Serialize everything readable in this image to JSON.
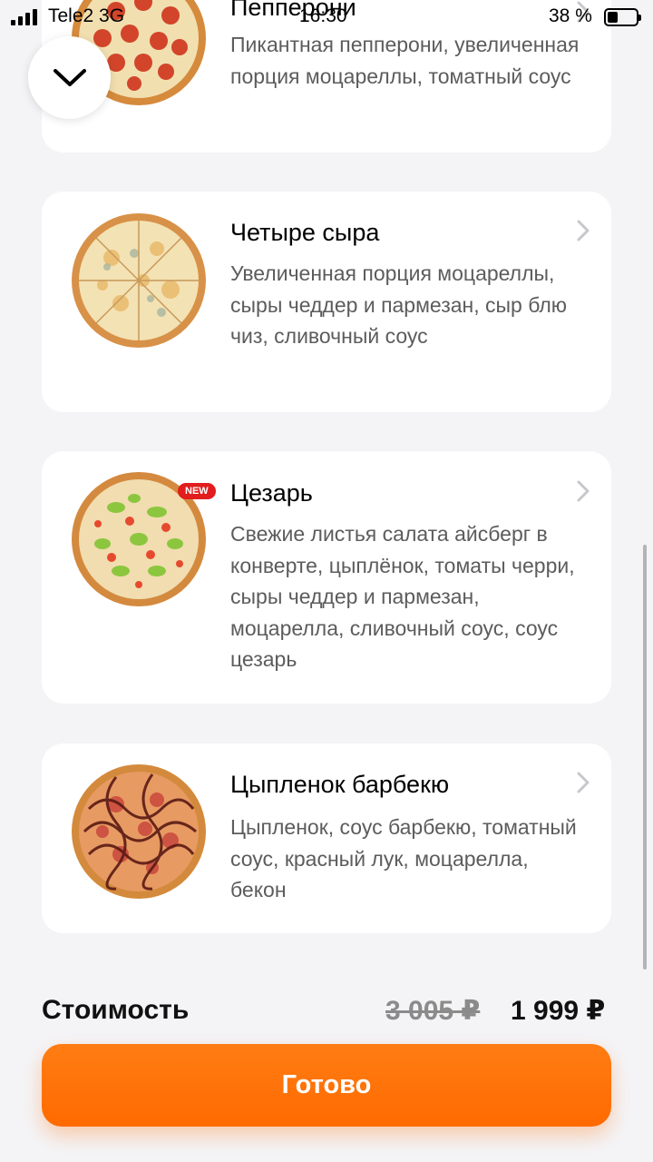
{
  "status_bar": {
    "carrier": "Tele2  3G",
    "time": "16:30",
    "battery": "38 %"
  },
  "colors": {
    "accent": "#ff6a00",
    "badge": "#e21d1d",
    "background": "#f4f4f6"
  },
  "items": [
    {
      "title": "Пепперони",
      "description": "Пикантная пепперони, увеличенная порция моцареллы, томатный соус",
      "icon": "pepperoni-pizza-image"
    },
    {
      "title": "Четыре сыра",
      "description": "Увеличенная порция моцареллы, сыры чеддер и пармезан, сыр блю чиз, сливочный соус",
      "icon": "four-cheese-pizza-image"
    },
    {
      "title": "Цезарь",
      "badge": "NEW",
      "description": "Свежие листья салата айсберг в конверте, цыплёнок, томаты черри, сыры чеддер и пармезан, моцарелла, сливочный соус, соус цезарь",
      "icon": "caesar-pizza-image"
    },
    {
      "title": "Цыпленок барбекю",
      "description": "Цыпленок, соус барбекю, томатный соус, красный лук, моцарелла, бекон",
      "icon": "bbq-chicken-pizza-image"
    }
  ],
  "footer": {
    "cost_label": "Стоимость",
    "old_price": "3 005 ₽",
    "new_price": "1 999 ₽",
    "done_label": "Готово"
  }
}
